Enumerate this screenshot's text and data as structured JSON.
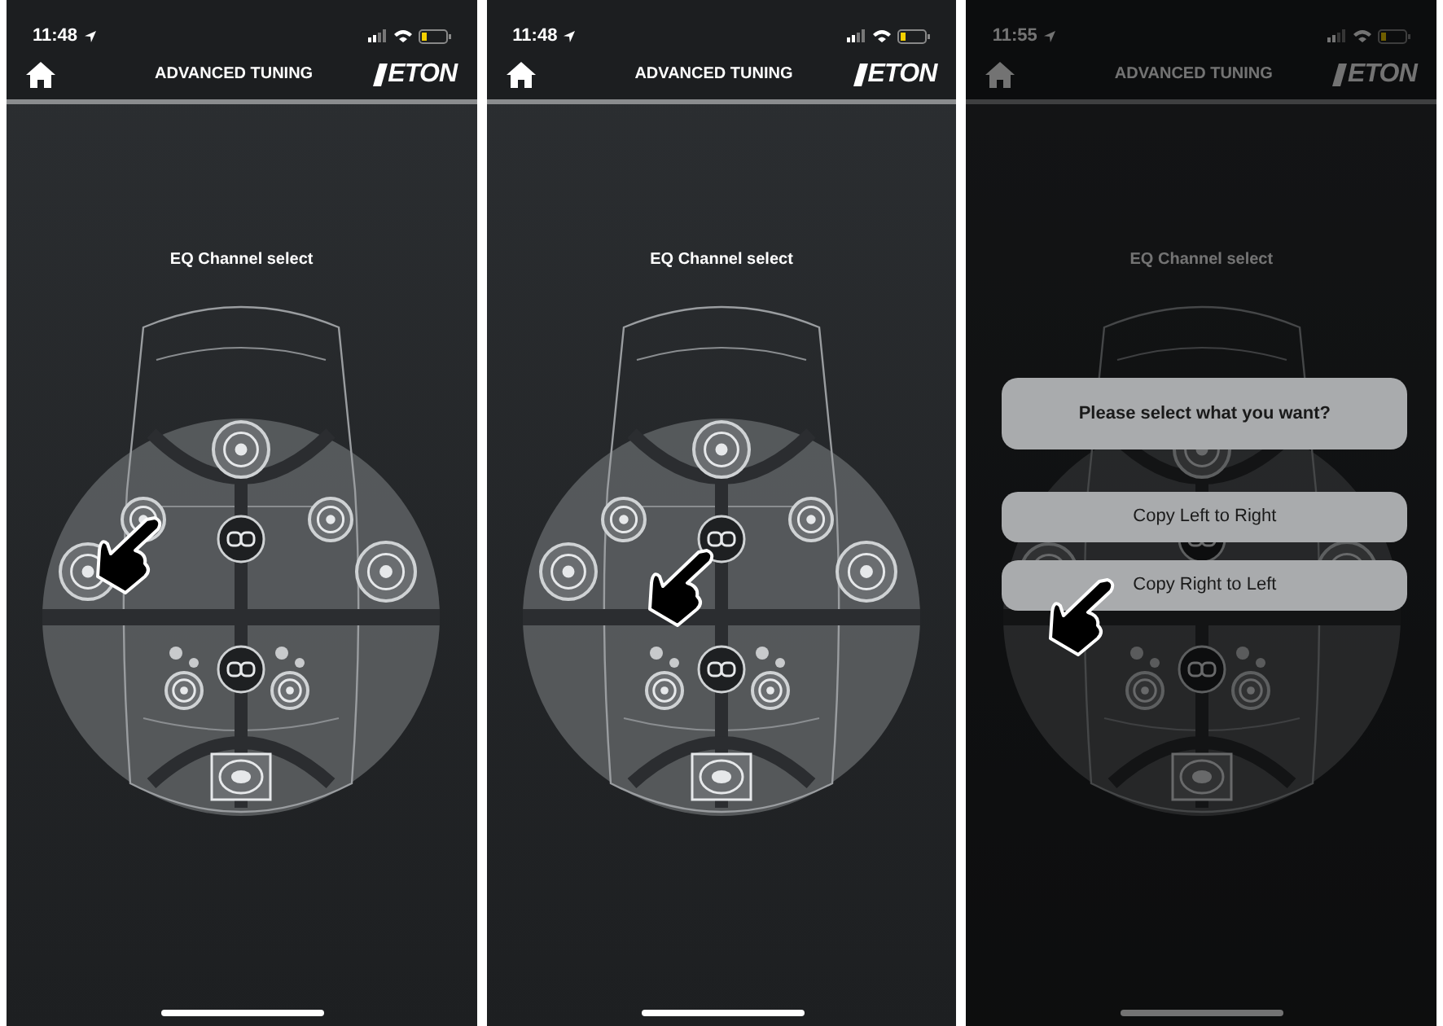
{
  "screens": [
    {
      "time": "11:48",
      "title": "ADVANCED TUNING",
      "logo": "ETON",
      "heading": "EQ Channel select",
      "pointer": {
        "kind": "left-door"
      },
      "dimmed": false
    },
    {
      "time": "11:48",
      "title": "ADVANCED TUNING",
      "logo": "ETON",
      "heading": "EQ Channel select",
      "pointer": {
        "kind": "center-link"
      },
      "dimmed": false
    },
    {
      "time": "11:55",
      "title": "ADVANCED TUNING",
      "logo": "ETON",
      "heading": "EQ Channel select",
      "pointer": {
        "kind": "dialog-option"
      },
      "dimmed": true,
      "dialog": {
        "title": "Please select what you want?",
        "options": [
          "Copy Left to Right",
          "Copy Right to Left"
        ]
      }
    }
  ]
}
